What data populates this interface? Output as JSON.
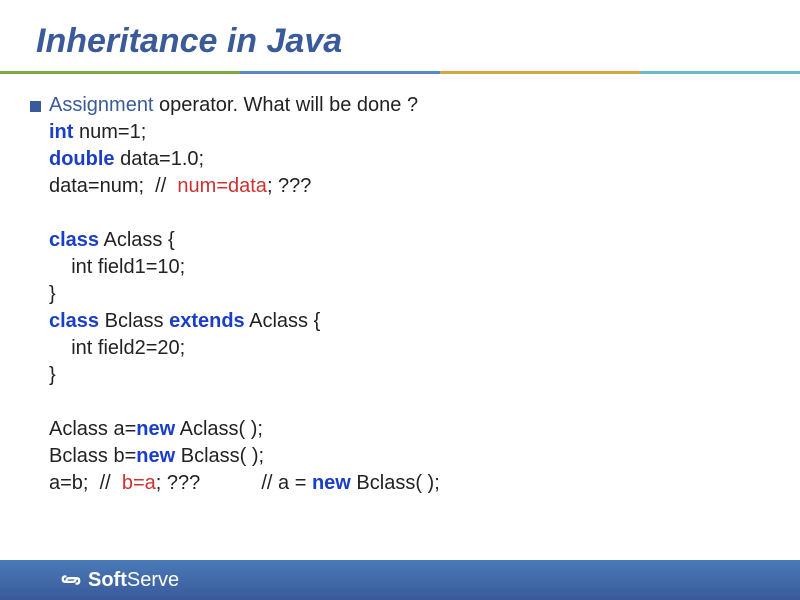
{
  "title": "Inheritance in Java",
  "content": {
    "assignment": "Assignment",
    "operator_text": " operator. What will be done ?",
    "line2a": "int",
    "line2b": " num=1;",
    "line3a": "double",
    "line3b": " data=1.0;",
    "line4a": "data=num;  //  ",
    "line4b": "num=data",
    "line4c": "; ???",
    "line6a": "class",
    "line6b": " Aclass {",
    "line7": "    int field1=10;",
    "line8": "}",
    "line9a": "class",
    "line9b": " Bclass ",
    "line9c": "extends",
    "line9d": " Aclass {",
    "line10": "    int field2=20;",
    "line11": "}",
    "line13a": "Aclass a=",
    "line13b": "new",
    "line13c": " Aclass( );",
    "line14a": "Bclass b=",
    "line14b": "new",
    "line14c": " Bclass( );",
    "line15a": "a=b;  //  ",
    "line15b": "b=a",
    "line15c": "; ???           // a = ",
    "line15d": "new",
    "line15e": " Bclass( );"
  },
  "footer": {
    "logo_text1": "Soft",
    "logo_text2": "Serve"
  }
}
